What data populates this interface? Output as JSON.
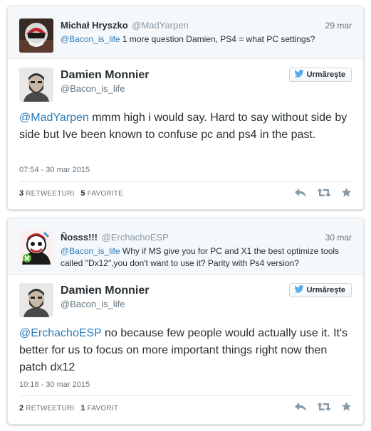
{
  "colors": {
    "link": "#2b7bb9",
    "text": "#292f33",
    "muted": "#66757f",
    "twitter_blue": "#55acee",
    "icon_gray": "#8899a6"
  },
  "tweets": [
    {
      "reply": {
        "name": "Michał Hryszko",
        "handle": "@MadYarpen",
        "date": "29 mar",
        "mention": "@Bacon_is_life",
        "text": " 1 more question Damien, PS4 = what PC settings?",
        "avatar_icon": "user-avatar-helmet"
      },
      "main": {
        "name": "Damien Monnier",
        "handle": "@Bacon_is_life",
        "follow_label": "Urmărește",
        "mention": "@MadYarpen",
        "text": " mmm high i would say. Hard to say without side by side but Ive been known to confuse pc and ps4 in the past.",
        "time": "07:54 - 30 mar 2015",
        "retweets": "3",
        "retweets_label": "RETWEETURI",
        "favorites": "5",
        "favorites_label": "FAVORITE"
      }
    },
    {
      "reply": {
        "name": "Ñosss!!!",
        "handle": "@ErchachoESP",
        "date": "30 mar",
        "mention": "@Bacon_is_life",
        "text": " Why if MS give you for PC and X1 the best optimize tools called \"Dx12\",you don't want to use it? Parity with Ps4 version?",
        "avatar_icon": "user-avatar-cartoon"
      },
      "main": {
        "name": "Damien Monnier",
        "handle": "@Bacon_is_life",
        "follow_label": "Urmărește",
        "mention": "@ErchachoESP",
        "text": " no because few people would actually use it. It's better for us to focus on more important things right now then patch  dx12",
        "time": "10:18 - 30 mar 2015",
        "retweets": "2",
        "retweets_label": "RETWEETURI",
        "favorites": "1",
        "favorites_label": "FAVORIT"
      }
    }
  ]
}
